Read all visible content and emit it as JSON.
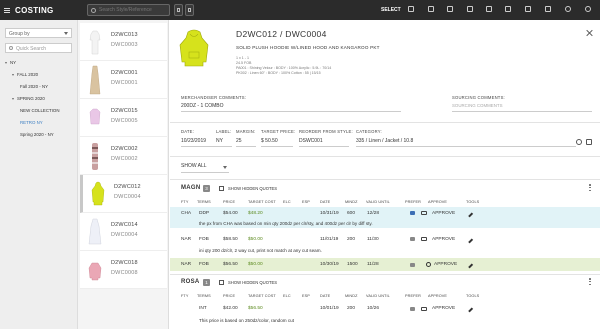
{
  "app": {
    "title": "COSTING"
  },
  "topbar": {
    "search_placeholder": "Search Style/Reference",
    "select_label": "SELECT"
  },
  "sidebar": {
    "group_by_label": "Group by",
    "quick_search_placeholder": "Quick Search",
    "tree": [
      {
        "label": "NY",
        "level": 0,
        "expanded": true
      },
      {
        "label": "FALL 2020",
        "level": 1,
        "expanded": true
      },
      {
        "label": "Fall 2020 - NY",
        "level": 2
      },
      {
        "label": "SPRING 2020",
        "level": 1,
        "expanded": true
      },
      {
        "label": "NEW COLLECTION",
        "level": 2
      },
      {
        "label": "RETRO NY",
        "level": 2,
        "active": true
      },
      {
        "label": "Spring 2020 - NY",
        "level": 2
      }
    ]
  },
  "styles": [
    {
      "code": "D2WC013",
      "ref": "DWC0003",
      "garment": "tee-white"
    },
    {
      "code": "D2WC001",
      "ref": "DWC0001",
      "garment": "dress-tan"
    },
    {
      "code": "D2WC015",
      "ref": "DWC0005",
      "garment": "top-pink"
    },
    {
      "code": "D2WC002",
      "ref": "DWC0002",
      "garment": "knit-stripe"
    },
    {
      "code": "D2WC012",
      "ref": "DWC0004",
      "garment": "hoodie-yellow",
      "selected": true
    },
    {
      "code": "D2WC014",
      "ref": "DWC0004",
      "garment": "dress-white"
    },
    {
      "code": "D2WC018",
      "ref": "DWC0008",
      "garment": "sweater-pink"
    }
  ],
  "detail": {
    "title": "D2WC012 / DWC0004",
    "description": "SOLID PLUSH HOODIE W/LINED HOOD AND KANGAROO PKT",
    "specs": [
      "1 x 1 - 1",
      "24.5 FOB",
      "PA001 : Shining Velour : BODY : 100% Acrylic : 5.9L : 70/14",
      "PK002 : Linen 60\" : BODY : 100% Cotton : 55 | 15/15"
    ],
    "merch_comments_label": "MERCHANDISER COMMENTS:",
    "merch_comments_value": "200DZ - 1 COMBO",
    "sourcing_comments_label": "SOURCING COMMENTS:",
    "sourcing_comments_placeholder": "SOURCING COMMENTS",
    "fields": {
      "date_label": "DATE:",
      "date_value": "10/23/2019",
      "label_label": "LABEL:",
      "label_value": "NY",
      "margin_label": "MARGIN:",
      "margin_value": "25",
      "target_price_label": "TARGET PRICE:",
      "target_price_value": "$ 50.50",
      "reorder_label": "REORDER FROM STYLE:",
      "reorder_value": "DSWC001",
      "category_label": "CATEGORY:",
      "category_value": "335 / Linen / Jacket / 10.8"
    },
    "filter_value": "SHOW ALL"
  },
  "quote_columns": [
    "FTY",
    "TERMS",
    "PRICE",
    "TARGET COST",
    "ELC",
    "ESP",
    "DATE",
    "MINDZ",
    "VALID UNTIL",
    "PREFER",
    "APPROVE",
    "TOOLS"
  ],
  "vendors": [
    {
      "name": "MAGN",
      "count": "3",
      "show_hidden_label": "SHOW HIDDEN QUOTES",
      "rows": [
        {
          "fty": "CHA",
          "terms": "DDP",
          "price": "$54.00",
          "target_cost": "$48.20",
          "date": "10/31/19",
          "mindz": "600",
          "valid": "12/28",
          "approve": "APPROVE",
          "highlight": "blue",
          "comment": "the px from CHA was based on min qty 200dz per clr/sty, and 400dz per clr by diff sty."
        },
        {
          "fty": "NAR",
          "terms": "FOB",
          "price": "$58.50",
          "target_cost": "$50.00",
          "date": "11/01/19",
          "mindz": "200",
          "valid": "11/30",
          "approve": "APPROVE",
          "highlight": "none",
          "comment": "ini qty 200 dz/clr, 2 way cut, print not match at any cut seam."
        },
        {
          "fty": "NAR",
          "terms": "FOB",
          "price": "$56.50",
          "target_cost": "$50.00",
          "date": "10/30/19",
          "mindz": "1500",
          "valid": "11/28",
          "approve": "APPROVE",
          "highlight": "green",
          "approved": true
        }
      ]
    },
    {
      "name": "ROSA",
      "count": "1",
      "show_hidden_label": "SHOW HIDDEN QUOTES",
      "rows": [
        {
          "fty": "INT",
          "terms": "",
          "price": "$42.00",
          "target_cost": "$56.50",
          "date": "10/01/19",
          "mindz": "200",
          "valid": "10/26",
          "approve": "APPROVE",
          "highlight": "none",
          "comment": "This price is based on 250dz/color, random cut"
        }
      ]
    }
  ],
  "colors": {
    "topbar": "#2b2b2b",
    "sidebar": "#eeeeee",
    "row_blue": "#e1f3f7",
    "row_green": "#e6f0d3",
    "accent": "#3d7fc2",
    "price_green": "#5b8a1e"
  }
}
